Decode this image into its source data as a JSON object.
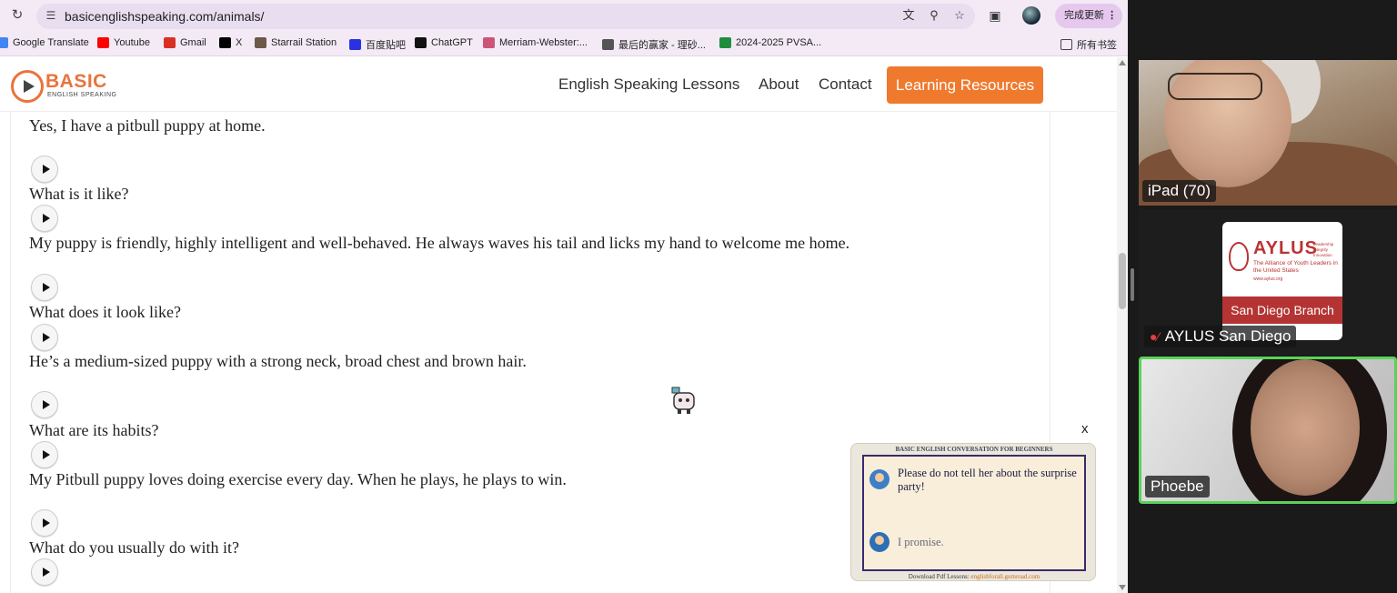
{
  "browser": {
    "url": "basicenglishspeaking.com/animals/",
    "update_label": "完成更新",
    "bookmarks": [
      {
        "label": "Google Translate",
        "icon": "translate-icon",
        "color": "#4285f4"
      },
      {
        "label": "Youtube",
        "icon": "youtube-icon",
        "color": "#ff0000"
      },
      {
        "label": "Gmail",
        "icon": "gmail-icon",
        "color": "#d93025"
      },
      {
        "label": "X",
        "icon": "x-icon",
        "color": "#000000"
      },
      {
        "label": "Starrail Station",
        "icon": "starrail-icon",
        "color": "#6b5a4a"
      },
      {
        "label": "百度贴吧",
        "icon": "baidu-icon",
        "color": "#2932e1"
      },
      {
        "label": "ChatGPT",
        "icon": "chatgpt-icon",
        "color": "#111111"
      },
      {
        "label": "Merriam-Webster:...",
        "icon": "mw-icon",
        "color": "#cc5577"
      },
      {
        "label": "最后的赢家 - 理砂...",
        "icon": "site-icon",
        "color": "#555555"
      },
      {
        "label": "2024-2025 PVSA...",
        "icon": "sheets-icon",
        "color": "#1e8e3e"
      }
    ],
    "all_bookmarks_label": "所有书签"
  },
  "site": {
    "logo_text": "BASIC",
    "logo_sub": "ENGLISH SPEAKING",
    "nav": [
      "English Speaking Lessons",
      "About",
      "Contact"
    ],
    "cta": "Learning Resources",
    "accent": "#ef7a2e"
  },
  "lesson": {
    "lines": [
      "Yes, I have a pitbull puppy at home.",
      "What is it like?",
      "My puppy is friendly, highly intelligent and well-behaved. He always waves his tail and licks my hand to welcome me home.",
      "What does it look like?",
      "He’s a medium-sized puppy with a strong neck, broad chest and brown hair.",
      "What are its habits?",
      "My Pitbull puppy loves doing exercise every day. When he plays, he plays to win.",
      "What do you usually do with it?"
    ]
  },
  "ad": {
    "close": "x",
    "header": "BASIC ENGLISH CONVERSATION FOR BEGINNERS",
    "line1": "Please do not tell her about the surprise party!",
    "line2": "I promise.",
    "footer_prefix": "Download Pdf Lessons: ",
    "footer_link": "englishforall.gumroad.com"
  },
  "video": {
    "tiles": [
      {
        "name": "iPad (70)"
      },
      {
        "name": "AYLUS San Diego",
        "muted": true
      },
      {
        "name": "Phoebe",
        "active": true
      }
    ],
    "aylus": {
      "name": "AYLUS",
      "tagline": "The Alliance of Youth Leaders in the United States",
      "mini": "Leadership\nIntegrity\nInnovation",
      "url": "www.aylus.org",
      "branch": "San Diego Branch"
    }
  }
}
